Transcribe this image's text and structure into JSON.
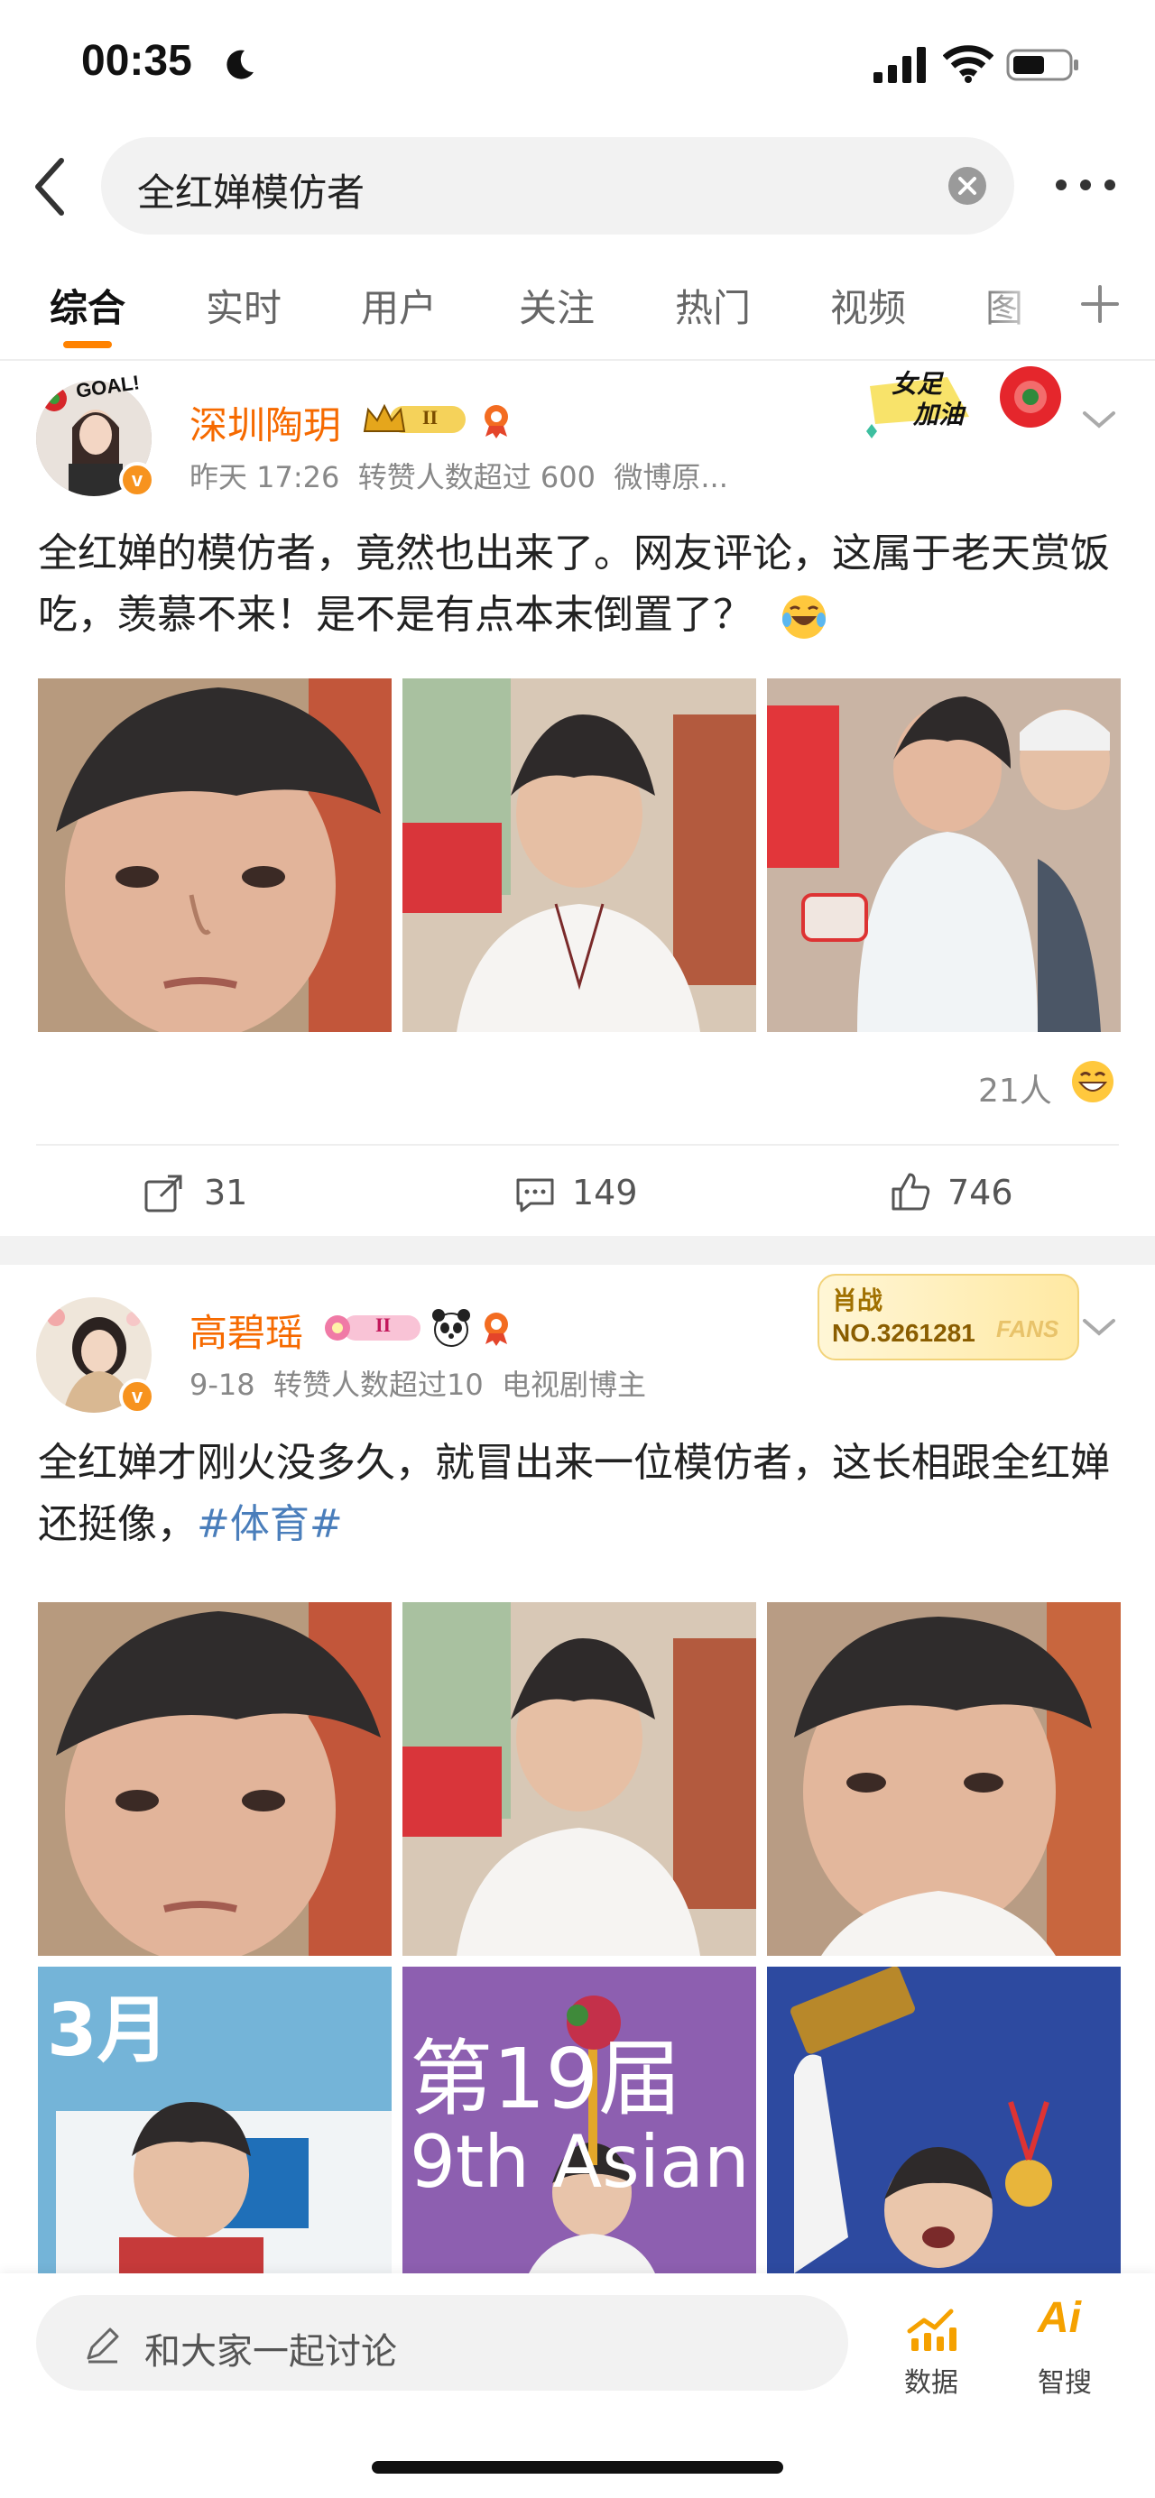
{
  "status_bar": {
    "time": "00:35"
  },
  "search": {
    "query": "全红婵模仿者"
  },
  "tabs": [
    "综合",
    "实时",
    "用户",
    "关注",
    "热门",
    "视频",
    "图"
  ],
  "posts": [
    {
      "username": "深圳陶玥",
      "level_badge": "II",
      "avatar_sticker": "GOAL!",
      "time": "昨天 17:26",
      "reposts_note": "转赞人数超过 600",
      "source": "微博原...",
      "banner_text": [
        "女足",
        "加油"
      ],
      "text": "全红婵的模仿者，竟然也出来了。网友评论，这属于老天赏饭吃，羡慕不来！是不是有点本末倒置了？",
      "likes_people": "21人",
      "reposts": "31",
      "comments": "149",
      "likes": "746"
    },
    {
      "username": "高碧瑶",
      "level_badge": "II",
      "time": "9-18",
      "reposts_note": "转赞人数超过10",
      "source": "电视剧博主",
      "fan_badge": {
        "title": "肖战",
        "number": "NO.3261281",
        "tag": "FANS"
      },
      "text": "全红婵才刚火没多久，就冒出来一位模仿者，这长相跟全红婵还挺像，",
      "hashtag": "#体育#",
      "photo_overlay": [
        "3月",
        "第19届",
        "9th Asian"
      ]
    }
  ],
  "bottom_bar": {
    "comment_placeholder": "和大家一起讨论",
    "data_label": "数据",
    "ai_label": "智搜",
    "ai_glyph": "Ai"
  },
  "colors": {
    "accent": "#ff8200",
    "username": "#f66a00",
    "hashtag": "#4a7ebb"
  }
}
